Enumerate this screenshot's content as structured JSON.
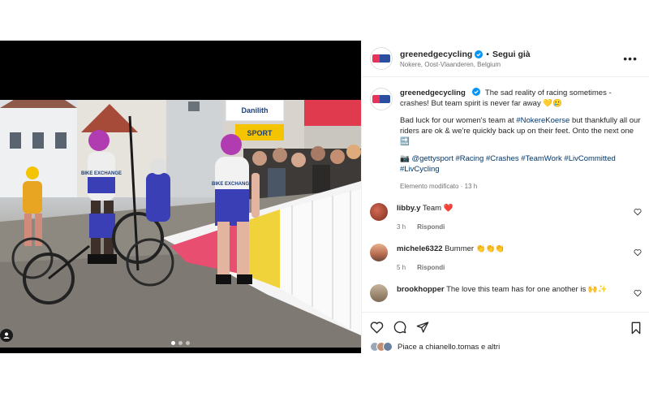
{
  "header": {
    "username": "greenedgecycling",
    "separator": "•",
    "follow_label": "Segui già",
    "location": "Nokere, Oost-Vlaanderen, Belgium",
    "more_label": "•••"
  },
  "caption": {
    "username": "greenedgecycling",
    "line1": "The sad reality of racing sometimes - crashes! But team spirit is never far away 💛🥲",
    "para2_before": "Bad luck for our women's team at ",
    "para2_hashtag": "#NokereKoerse",
    "para2_after": " but thankfully all our riders are ok & we're quickly back up on their feet. Onto the next one 🔜",
    "credit_prefix": "📷 ",
    "credit_handle": "@gettysport",
    "hashtags": "#Racing #Crashes #TeamWork #LivCommitted #LivCycling",
    "meta": "Elemento modificato · 13 h"
  },
  "comments": [
    {
      "username": "libby.y",
      "text": "Team ❤️",
      "time": "3 h",
      "reply": "Rispondi"
    },
    {
      "username": "michele6322",
      "text": "Bummer 👏👏👏",
      "time": "5 h",
      "reply": "Rispondi"
    },
    {
      "username": "brookhopper",
      "text": "The love this team has for one another is 🙌✨"
    }
  ],
  "likes": {
    "text": "Piace a chianello.tomas e altri"
  },
  "media": {
    "banner_danilith": "Danilith",
    "banner_sport": "SPORT",
    "jersey_text": "BIKE EXCHANGE"
  },
  "colors": {
    "accent_blue": "#0095f6",
    "link_blue": "#00376b",
    "heart_red": "#ed1c24",
    "brand_pink": "#e8325a",
    "brand_blue": "#2b4ea0"
  },
  "icons": [
    "verified-badge-icon",
    "more-options-icon",
    "heart-icon",
    "comment-icon",
    "share-icon",
    "bookmark-icon",
    "tag-people-icon"
  ]
}
